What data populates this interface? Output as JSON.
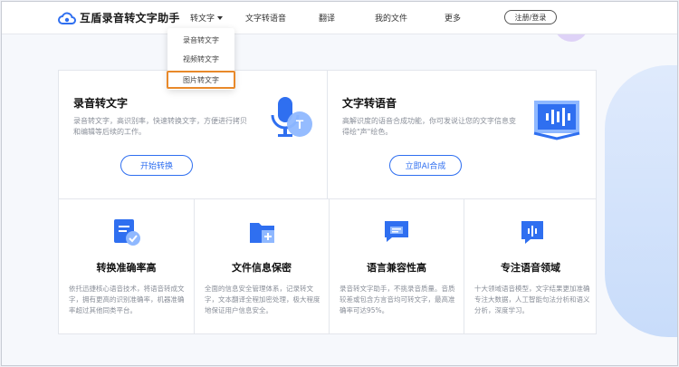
{
  "header": {
    "logo_text": "互盾录音转文字助手",
    "nav": [
      "转文字",
      "文字转语音",
      "翻译",
      "我的文件",
      "更多"
    ],
    "login_label": "注册/登录"
  },
  "dropdown": {
    "items": [
      "录音转文字",
      "视频转文字",
      "图片转文字"
    ],
    "highlighted_index": 2
  },
  "features": [
    {
      "title": "录音转文字",
      "desc": "录音转文字，高识别率，快速转换文字，方便进行拷贝和编辑等后续的工作。",
      "button": "开始转换",
      "icon": "microphone-text-icon"
    },
    {
      "title": "文字转语音",
      "desc": "高解识度的语音合成功能，你可发说让您的文字信息变得绘\"声\"绘色。",
      "button": "立即AI合成",
      "icon": "book-soundwave-icon"
    }
  ],
  "advantages": [
    {
      "title": "转换准确率高",
      "desc": "依托迅捷核心语音技术，将语音转成文字，拥有更高的识别准确率，机器准确率超过其他同类平台。",
      "icon": "document-check-icon"
    },
    {
      "title": "文件信息保密",
      "desc": "全面的信息安全管理体系，记录转文字，文本翻译全程加密处理，极大程度地保证用户信息安全。",
      "icon": "folder-shield-icon"
    },
    {
      "title": "语言兼容性高",
      "desc": "录音转文字助手，不挑录音质量。音质较差或包含方言音均可转文字，最高准确率可达95%。",
      "icon": "chat-bubbles-icon"
    },
    {
      "title": "专注语音领域",
      "desc": "十大领域语音模型，文字结果更加准确专注大数据，人工智能句法分析和语义分析，深度学习。",
      "icon": "voice-bubble-icon"
    }
  ],
  "colors": {
    "accent": "#2f6ff0",
    "highlight": "#e8892a",
    "icon_light": "#8fb8ff"
  }
}
